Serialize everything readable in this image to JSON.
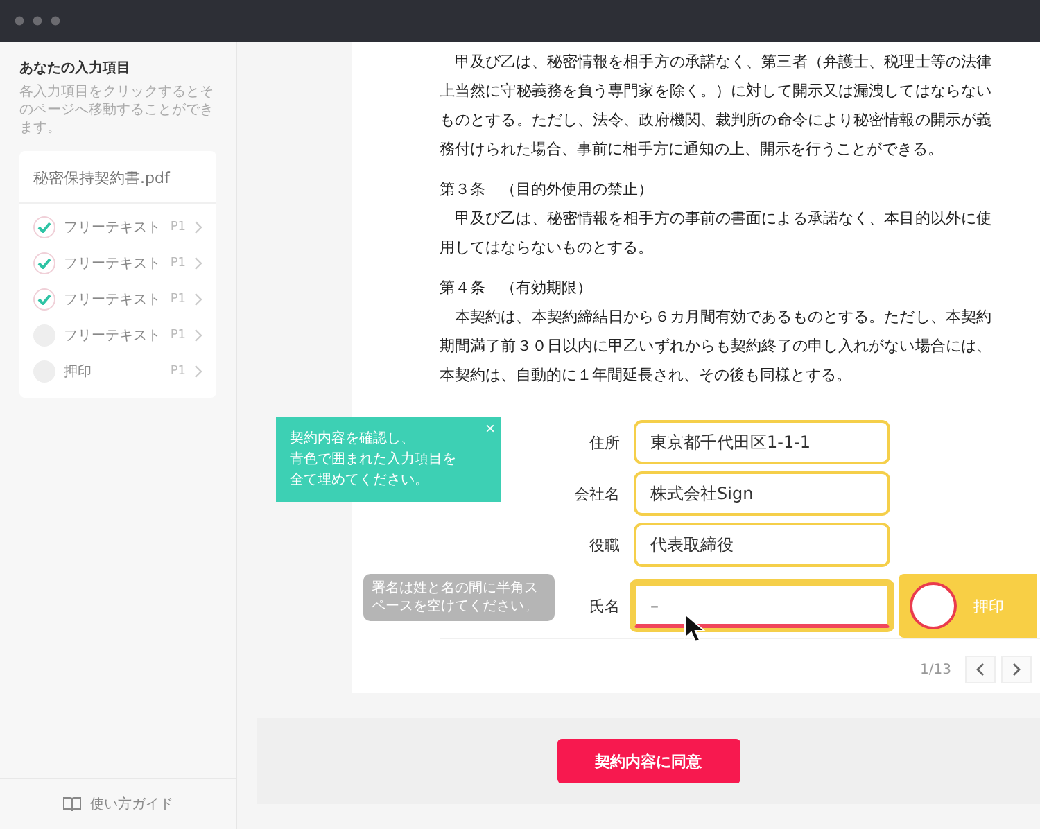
{
  "sidebar": {
    "title": "あなたの入力項目",
    "description": "各入力項目をクリックするとそのページへ移動することができます。",
    "file_name": "秘密保持契約書.pdf",
    "items": [
      {
        "label": "フリーテキスト",
        "page": "P1",
        "checked": true
      },
      {
        "label": "フリーテキスト",
        "page": "P1",
        "checked": true
      },
      {
        "label": "フリーテキスト",
        "page": "P1",
        "checked": true
      },
      {
        "label": "フリーテキスト",
        "page": "P1",
        "checked": false
      },
      {
        "label": "押印",
        "page": "P1",
        "checked": false
      }
    ],
    "guide_link": "使い方ガイド"
  },
  "document": {
    "blocks": [
      {
        "kind": "paragraph",
        "text": "甲及び乙は、秘密情報を相手方の承諾なく、第三者（弁護士、税理士等の法律上当然に守秘義務を負う専門家を除く。）に対して開示又は漏洩してはならないものとする。ただし、法令、政府機関、裁判所の命令により秘密情報の開示が義務付けられた場合、事前に相手方に通知の上、開示を行うことができる。"
      },
      {
        "kind": "heading",
        "text": "第３条　（目的外使用の禁止）"
      },
      {
        "kind": "paragraph",
        "text": "甲及び乙は、秘密情報を相手方の事前の書面による承諾なく、本目的以外に使用してはならないものとする。"
      },
      {
        "kind": "heading",
        "text": "第４条　（有効期限）"
      },
      {
        "kind": "paragraph",
        "text": "本契約は、本契約締結日から６カ月間有効であるものとする。ただし、本契約期間満了前３０日以内に甲乙いずれからも契約終了の申し入れがない場合には、本契約は、自動的に１年間延長され、その後も同様とする。"
      }
    ],
    "fields": [
      {
        "label": "住所",
        "value": "東京都千代田区1-1-1",
        "focused": false
      },
      {
        "label": "会社名",
        "value": "株式会社Sign",
        "focused": false
      },
      {
        "label": "役職",
        "value": "代表取締役",
        "focused": false
      },
      {
        "label": "氏名",
        "value": "–",
        "focused": true
      }
    ],
    "name_hint": "署名は姓と名の間に半角スペースを空けてください。",
    "stamp_button": "押印",
    "tooltip": {
      "lines": [
        "契約内容を確認し、",
        "青色で囲まれた入力項目を",
        "全て埋めてください。"
      ],
      "close": "×"
    },
    "page_indicator": "1/13"
  },
  "agree_button": "契約内容に同意"
}
